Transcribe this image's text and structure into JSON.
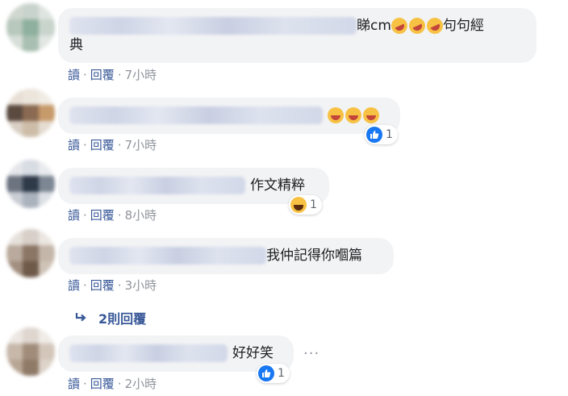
{
  "comments": [
    {
      "suffix_text": "睇cm",
      "emoji_count": 3,
      "emoji_name": "rolling-on-floor-laughing",
      "text_line2": "句句經典",
      "second_line": "典",
      "first_line_tail": "句句經",
      "action_read": "讀",
      "action_reply": "回覆",
      "time": "7小時",
      "reaction": null
    },
    {
      "suffix_text": "",
      "emoji_count": 3,
      "emoji_name": "grinning-face-with-sweat",
      "action_read": "讀",
      "action_reply": "回覆",
      "time": "7小時",
      "reaction": {
        "icon": "like-icon",
        "count": "1"
      }
    },
    {
      "suffix_text": "作文精粹",
      "emoji_count": 0,
      "action_read": "讀",
      "action_reply": "回覆",
      "time": "8小時",
      "reaction": {
        "icon": "haha-icon",
        "count": "1"
      }
    },
    {
      "suffix_text": "我仲記得你嗰篇",
      "emoji_count": 0,
      "action_read": "讀",
      "action_reply": "回覆",
      "time": "3小時",
      "reaction": null
    },
    {
      "suffix_text": "好好笑",
      "emoji_count": 0,
      "action_read": "讀",
      "action_reply": "回覆",
      "time": "2小時",
      "reaction": {
        "icon": "like-icon",
        "count": "1"
      }
    }
  ],
  "replies_link": {
    "label": "2則回覆"
  },
  "more_options": "···",
  "separator": "·",
  "colors": {
    "link": "#385898",
    "muted": "#90949c",
    "bubble": "#f2f3f5",
    "like": "#1877f2"
  }
}
